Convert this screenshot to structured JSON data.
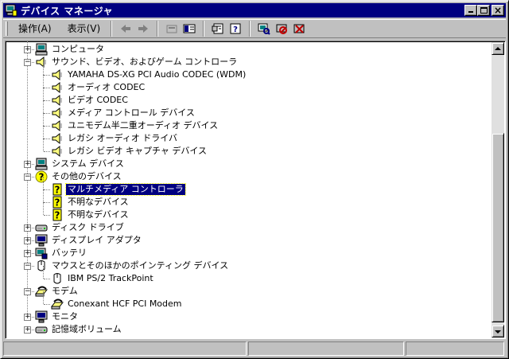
{
  "window": {
    "title": "デバイス マネージャ"
  },
  "menu": {
    "action": "操作(A)",
    "view": "表示(V)"
  },
  "colors": {
    "title_bar": "#000080",
    "selection": "#000080",
    "face": "#c0c0c0"
  },
  "tree": {
    "nodes": [
      {
        "label": "コンピュータ",
        "icon": "computer-icon",
        "expander": "+"
      },
      {
        "label": "サウンド、ビデオ、およびゲーム コントローラ",
        "icon": "speaker-icon",
        "expander": "−"
      },
      {
        "label": "YAMAHA DS-XG PCI Audio CODEC (WDM)",
        "icon": "speaker-icon"
      },
      {
        "label": "オーディオ CODEC",
        "icon": "speaker-icon"
      },
      {
        "label": "ビデオ CODEC",
        "icon": "speaker-icon"
      },
      {
        "label": "メディア コントロール デバイス",
        "icon": "speaker-icon"
      },
      {
        "label": "ユニモデム半二重オーディオ デバイス",
        "icon": "speaker-icon"
      },
      {
        "label": "レガシ オーディオ ドライバ",
        "icon": "speaker-icon"
      },
      {
        "label": "レガシ ビデオ キャプチャ デバイス",
        "icon": "speaker-icon"
      },
      {
        "label": "システム デバイス",
        "icon": "computer-icon",
        "expander": "+"
      },
      {
        "label": "その他のデバイス",
        "icon": "question-icon",
        "expander": "−"
      },
      {
        "label": "マルチメディア コントローラ",
        "icon": "unknown-device-icon",
        "selected": true
      },
      {
        "label": "不明なデバイス",
        "icon": "unknown-device-icon"
      },
      {
        "label": "不明なデバイス",
        "icon": "unknown-device-icon"
      },
      {
        "label": "ディスク ドライブ",
        "icon": "disk-drive-icon",
        "expander": "+"
      },
      {
        "label": "ディスプレイ アダプタ",
        "icon": "monitor-icon",
        "expander": "+"
      },
      {
        "label": "バッテリ",
        "icon": "battery-icon",
        "expander": "+"
      },
      {
        "label": "マウスとそのほかのポインティング デバイス",
        "icon": "mouse-icon",
        "expander": "−"
      },
      {
        "label": "IBM PS/2 TrackPoint",
        "icon": "mouse-icon"
      },
      {
        "label": "モデム",
        "icon": "modem-icon",
        "expander": "−"
      },
      {
        "label": "Conexant HCF PCI Modem",
        "icon": "modem-icon"
      },
      {
        "label": "モニタ",
        "icon": "monitor-icon",
        "expander": "+"
      },
      {
        "label": "記憶域ボリューム",
        "icon": "disk-drive-icon",
        "expander": "+"
      }
    ]
  }
}
